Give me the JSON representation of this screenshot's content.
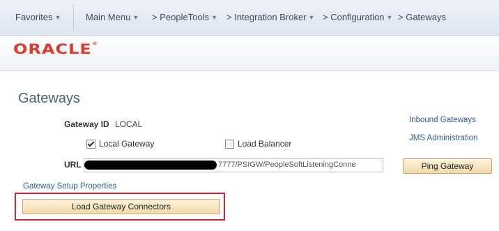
{
  "nav": {
    "favorites": "Favorites",
    "main_menu": "Main Menu",
    "crumbs": [
      "> PeopleTools",
      "> Integration Broker",
      "> Configuration",
      "> Gateways"
    ],
    "arrow_glyph": "▼"
  },
  "brand": {
    "logo": "ORACLE",
    "mark": "®"
  },
  "page": {
    "title": "Gateways",
    "gateway_id_label": "Gateway ID",
    "gateway_id_value": "LOCAL",
    "local_gateway": {
      "label": "Local Gateway",
      "checked": true
    },
    "load_balancer": {
      "label": "Load Balancer",
      "checked": false
    },
    "url_label": "URL",
    "url_value_visible": "7777/PSIGW/PeopleSoftListeningConne",
    "setup_link": "Gateway Setup Properties",
    "load_connectors_button": "Load Gateway Connectors"
  },
  "side": {
    "inbound_link": "Inbound Gateways",
    "jms_link": "JMS Administration",
    "ping_button": "Ping Gateway"
  },
  "colors": {
    "oracle_red": "#e03a2b",
    "highlight_red": "#d6232a",
    "button_fill": "#f2d9a8",
    "link_blue": "#2e5a9a"
  }
}
